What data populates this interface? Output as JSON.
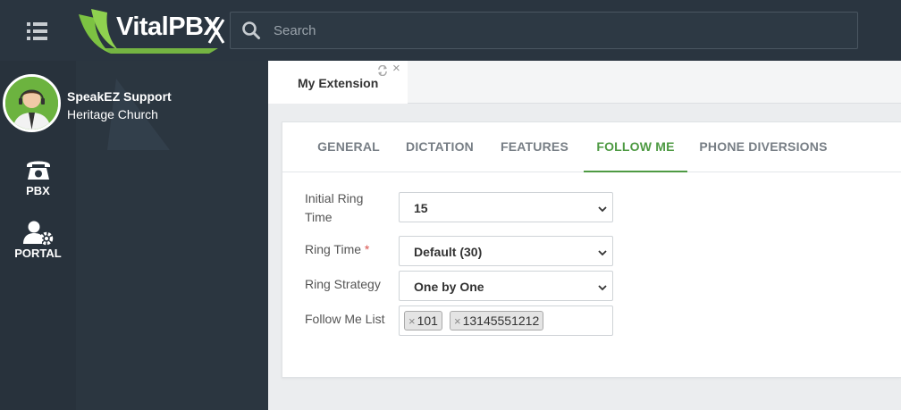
{
  "header": {
    "logo_text_vital": "Vital",
    "logo_text_pbx": "PBX",
    "search": {
      "placeholder": "Search"
    }
  },
  "sidebar": {
    "user": {
      "name": "SpeakEZ Support",
      "org": "Heritage Church"
    },
    "items": [
      {
        "label": "PBX",
        "icon": "phone-icon"
      },
      {
        "label": "PORTAL",
        "icon": "user-gear-icon"
      }
    ]
  },
  "page_tabs": [
    {
      "label": "My Extension"
    }
  ],
  "form_tabs": [
    {
      "label": "GENERAL"
    },
    {
      "label": "DICTATION"
    },
    {
      "label": "FEATURES"
    },
    {
      "label": "FOLLOW ME",
      "active": true
    },
    {
      "label": "PHONE DIVERSIONS"
    }
  ],
  "form": {
    "initial_ring_time": {
      "label": "Initial Ring Time",
      "value": "15"
    },
    "ring_time": {
      "label": "Ring Time",
      "required_mark": "*",
      "value": "Default (30)"
    },
    "ring_strategy": {
      "label": "Ring Strategy",
      "value": "One by One"
    },
    "follow_me_list": {
      "label": "Follow Me List",
      "tags": [
        "101",
        "13145551212"
      ],
      "remove_symbol": "×"
    }
  },
  "colors": {
    "topbar": "#2a3540",
    "sidebar": "#2b3640",
    "accent_green": "#4e9a43",
    "required_red": "#d9534f"
  }
}
